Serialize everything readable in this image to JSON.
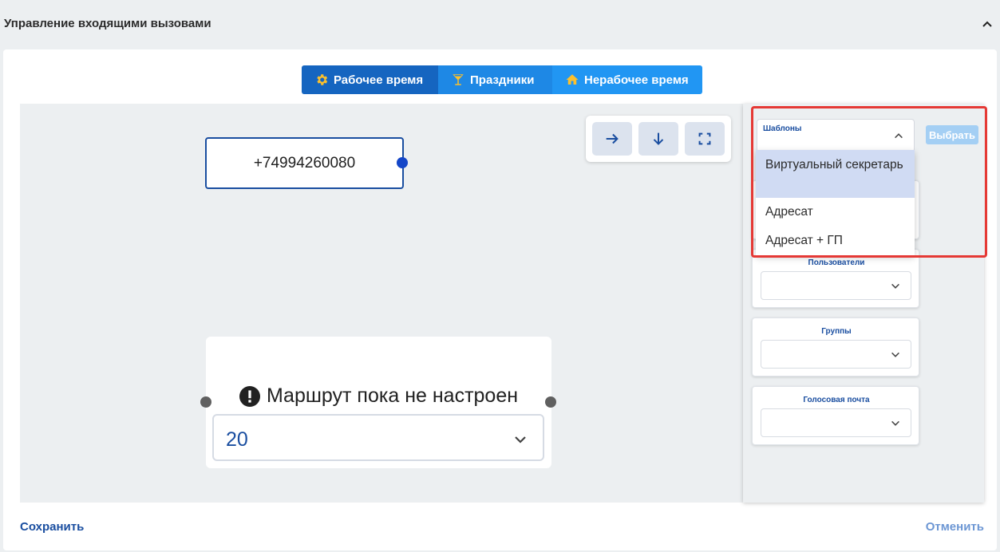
{
  "header": {
    "title": "Управление входящими вызовами"
  },
  "tabs": [
    {
      "label": "Рабочее время",
      "icon": "gear-icon"
    },
    {
      "label": "Праздники",
      "icon": "cocktail-icon"
    },
    {
      "label": "Нерабочее время",
      "icon": "home-icon"
    }
  ],
  "toolbar": {
    "icons": [
      "arrow-right-icon",
      "arrow-down-icon",
      "fullscreen-icon"
    ]
  },
  "flow": {
    "phone_node": "+74994260080",
    "route_node": {
      "title": "Маршрут пока не настроен",
      "value": "20"
    }
  },
  "panel": {
    "templates_label": "Шаблоны",
    "pick_label": "Выбрать",
    "dropdown_options": [
      "Виртуальный секретарь",
      "Адресат",
      "Адресат + ГП"
    ],
    "fields": [
      {
        "label": ""
      },
      {
        "label": "Пользователи"
      },
      {
        "label": "Группы"
      },
      {
        "label": "Голосовая почта"
      }
    ]
  },
  "footer": {
    "save_label": "Сохранить",
    "cancel_label": "Отменить"
  },
  "colors": {
    "primary": "#1565c0",
    "accent": "#2196f3",
    "highlight": "#e53935",
    "handle": "#1446c8"
  }
}
